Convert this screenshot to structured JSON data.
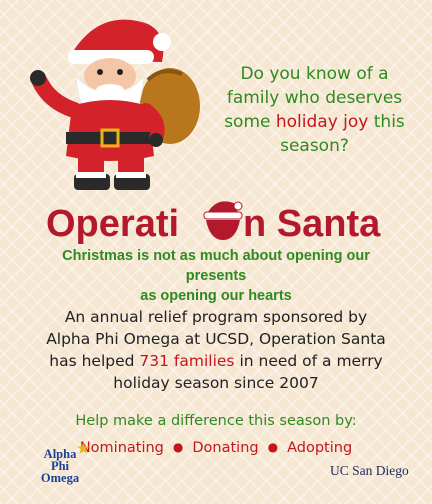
{
  "question": {
    "line1": "Do you know of a",
    "line2": "family who deserves",
    "line3_pre": "some ",
    "line3_highlight": "holiday joy",
    "line3_post": " this",
    "line4": "season?"
  },
  "title": {
    "part1": "Operati",
    "part2": "n Santa"
  },
  "tagline": {
    "line1": "Christmas is not as much about opening our presents",
    "line2": "as opening our hearts"
  },
  "description": {
    "line1": "An annual relief program sponsored by",
    "line2": "Alpha Phi Omega at UCSD, Operation Santa",
    "line3_pre": "has helped ",
    "line3_highlight": "731 families",
    "line3_post": " in need of a merry",
    "line4": "holiday season since 2007"
  },
  "cta": "Help make a difference this season by:",
  "actions": [
    "Nominating",
    "Donating",
    "Adopting"
  ],
  "logos": {
    "apo_line1": "Alpha",
    "apo_line2": "Phi",
    "apo_line3": "Omega",
    "ucsd": "UC San Diego"
  },
  "colors": {
    "green": "#2f8a22",
    "red": "#c4161c",
    "background": "#f6e7d3"
  }
}
